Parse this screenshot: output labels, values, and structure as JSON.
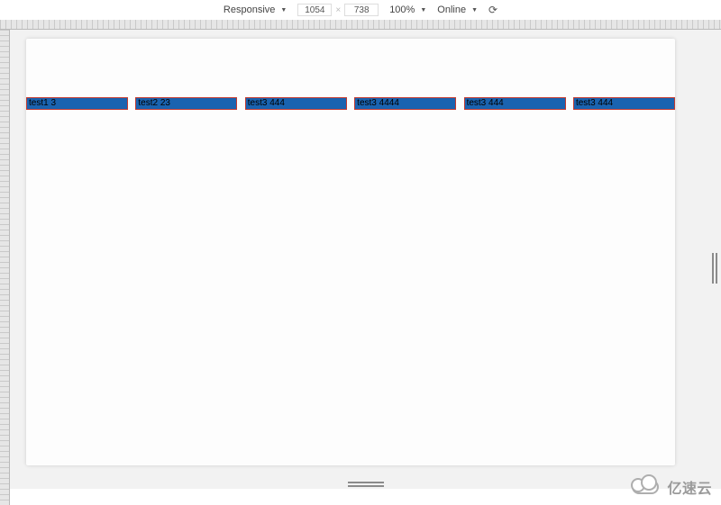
{
  "devtools": {
    "device_mode_label": "Responsive",
    "width": "1054",
    "height": "738",
    "dim_separator": "×",
    "zoom_label": "100%",
    "network_label": "Online"
  },
  "page": {
    "items": [
      {
        "label": "test1 3"
      },
      {
        "label": "test2 23"
      },
      {
        "label": "test3 444"
      },
      {
        "label": "test3 4444"
      },
      {
        "label": "test3 444"
      },
      {
        "label": "test3 444"
      }
    ],
    "item_style": {
      "background": "#1a63b0",
      "border": "#c13a30"
    }
  },
  "watermark": {
    "text": "亿速云"
  }
}
